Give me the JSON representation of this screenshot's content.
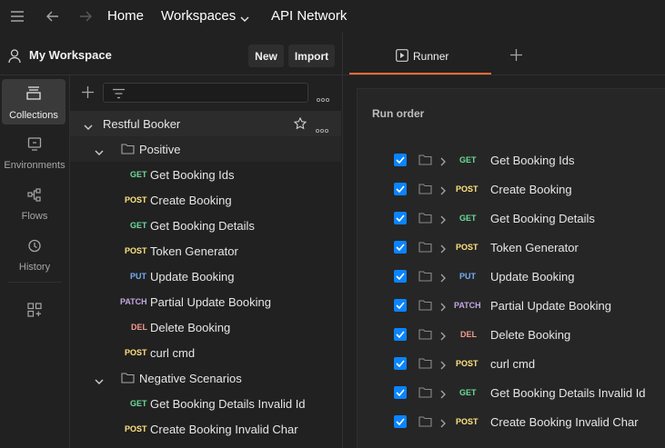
{
  "topbar": {
    "home": "Home",
    "workspaces": "Workspaces",
    "api_network": "API Network"
  },
  "workspace": {
    "title": "My Workspace",
    "new_label": "New",
    "import_label": "Import"
  },
  "rail": [
    {
      "label": "Collections"
    },
    {
      "label": "Environments"
    },
    {
      "label": "Flows"
    },
    {
      "label": "History"
    }
  ],
  "tree": {
    "collection": "Restful Booker",
    "folders": [
      "Positive",
      "Negative Scenarios"
    ],
    "requests": [
      {
        "method": "GET",
        "name": "Get Booking Ids"
      },
      {
        "method": "POST",
        "name": "Create Booking"
      },
      {
        "method": "GET",
        "name": "Get Booking Details"
      },
      {
        "method": "POST",
        "name": "Token Generator"
      },
      {
        "method": "PUT",
        "name": "Update Booking"
      },
      {
        "method": "PATCH",
        "name": "Partial Update Booking"
      },
      {
        "method": "DEL",
        "name": "Delete Booking"
      },
      {
        "method": "POST",
        "name": "curl cmd"
      },
      {
        "method": "GET",
        "name": "Get Booking Details Invalid Id"
      },
      {
        "method": "POST",
        "name": "Create Booking Invalid Char"
      }
    ]
  },
  "runner": {
    "tab_label": "Runner",
    "run_order_label": "Run order",
    "items": [
      {
        "method": "GET",
        "name": "Get Booking Ids"
      },
      {
        "method": "POST",
        "name": "Create Booking"
      },
      {
        "method": "GET",
        "name": "Get Booking Details"
      },
      {
        "method": "POST",
        "name": "Token Generator"
      },
      {
        "method": "PUT",
        "name": "Update Booking"
      },
      {
        "method": "PATCH",
        "name": "Partial Update Booking"
      },
      {
        "method": "DEL",
        "name": "Delete Booking"
      },
      {
        "method": "POST",
        "name": "curl cmd"
      },
      {
        "method": "GET",
        "name": "Get Booking Details Invalid Id"
      },
      {
        "method": "POST",
        "name": "Create Booking Invalid Char"
      }
    ]
  }
}
